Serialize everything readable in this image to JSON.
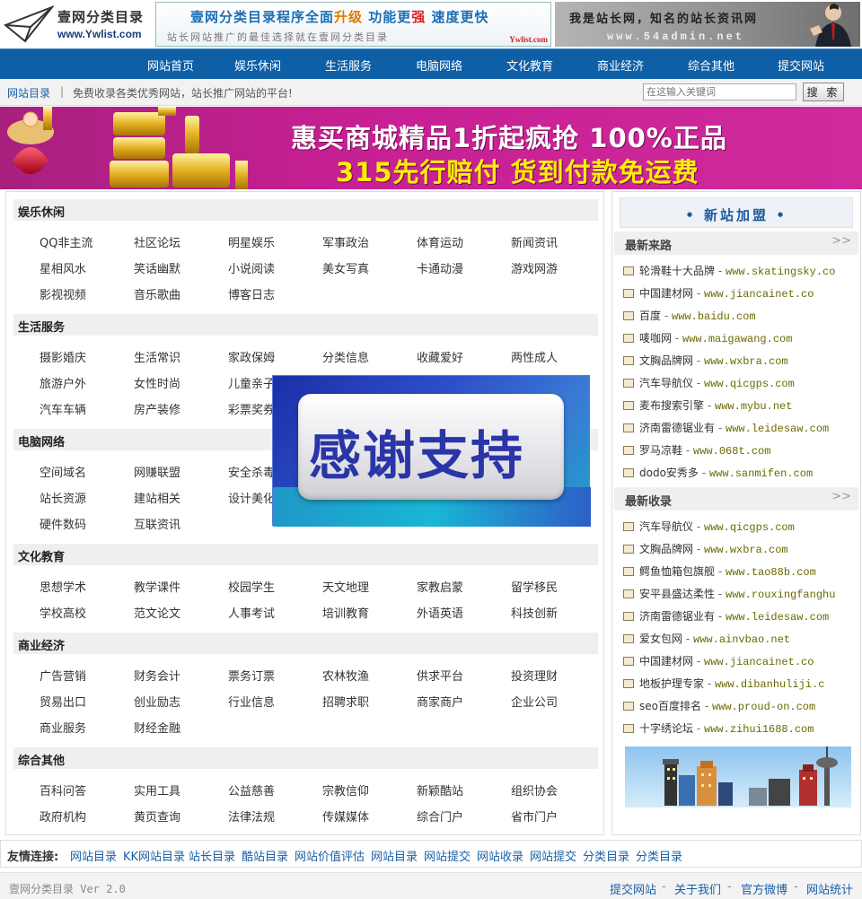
{
  "header": {
    "logo_title": "壹网分类目录",
    "logo_url": "www.Ywlist.com",
    "ad1": {
      "line1_a": "壹网分类目录程序全面",
      "line1_b": "升级",
      "line1_c": " 功能更",
      "line1_d": "强",
      "line1_e": " 速度更快",
      "line2": "站长网站推广的最佳选择就在壹网分类目录",
      "tag": "Ywlist.com"
    },
    "ad2": {
      "line1": "我是站长网，知名的站长资讯网",
      "line2": "www.54admin.net"
    }
  },
  "nav": [
    "网站首页",
    "娱乐休闲",
    "生活服务",
    "电脑网络",
    "文化教育",
    "商业经济",
    "综合其他",
    "提交网站"
  ],
  "subbar": {
    "crumb": "网站目录",
    "separator": "|",
    "desc": "免费收录各类优秀网站，站长推广网站的平台!",
    "search_placeholder": "在这输入关键词",
    "search_button": "搜 索"
  },
  "banner": {
    "line1": "惠买商城精品1折起疯抢 100%正品",
    "line2": "315先行赔付 货到付款免运费"
  },
  "categories": [
    {
      "title": "娱乐休闲",
      "links": [
        "QQ非主流",
        "社区论坛",
        "明星娱乐",
        "军事政治",
        "体育运动",
        "新闻资讯",
        "星相风水",
        "笑话幽默",
        "小说阅读",
        "美女写真",
        "卡通动漫",
        "游戏网游",
        "影视视频",
        "音乐歌曲",
        "博客日志"
      ]
    },
    {
      "title": "生活服务",
      "links": [
        "摄影婚庆",
        "生活常识",
        "家政保姆",
        "分类信息",
        "收藏爱好",
        "两性成人",
        "旅游户外",
        "女性时尚",
        "儿童亲子",
        "",
        "",
        "",
        "汽车车辆",
        "房产装修",
        "彩票奖券"
      ]
    },
    {
      "title": "电脑网络",
      "links": [
        "空间域名",
        "网赚联盟",
        "安全杀毒",
        "",
        "",
        "",
        "站长资源",
        "建站相关",
        "设计美化",
        "",
        "",
        "",
        "硬件数码",
        "互联资讯"
      ]
    },
    {
      "title": "文化教育",
      "links": [
        "思想学术",
        "教学课件",
        "校园学生",
        "天文地理",
        "家教启蒙",
        "留学移民",
        "学校高校",
        "范文论文",
        "人事考试",
        "培训教育",
        "外语英语",
        "科技创新"
      ]
    },
    {
      "title": "商业经济",
      "links": [
        "广告营销",
        "财务会计",
        "票务订票",
        "农林牧渔",
        "供求平台",
        "投资理财",
        "贸易出口",
        "创业励志",
        "行业信息",
        "招聘求职",
        "商家商户",
        "企业公司",
        "商业服务",
        "财经金融"
      ]
    },
    {
      "title": "综合其他",
      "links": [
        "百科问答",
        "实用工具",
        "公益慈善",
        "宗教信仰",
        "新颖酷站",
        "组织协会",
        "政府机构",
        "黄页查询",
        "法律法规",
        "传媒媒体",
        "综合门户",
        "省市门户"
      ]
    }
  ],
  "popup": {
    "text": "感谢支持"
  },
  "sidebar": {
    "join": "• 新站加盟 •",
    "latest_visits": {
      "title": "最新来路",
      "more": ">>",
      "items": [
        {
          "name": "轮滑鞋十大品牌",
          "url": "www.skatingsky.co"
        },
        {
          "name": "中国建材网",
          "url": "www.jiancainet.co"
        },
        {
          "name": "百度",
          "url": "www.baidu.com"
        },
        {
          "name": "唛咖网",
          "url": "www.maigawang.com"
        },
        {
          "name": "文胸品牌网",
          "url": "www.wxbra.com"
        },
        {
          "name": "汽车导航仪",
          "url": "www.qicgps.com"
        },
        {
          "name": "麦布搜索引擎",
          "url": "www.mybu.net"
        },
        {
          "name": "济南雷德锯业有",
          "url": "www.leidesaw.com"
        },
        {
          "name": "罗马凉鞋",
          "url": "www.068t.com"
        },
        {
          "name": "dodo安秀多",
          "url": "www.sanmifen.com"
        }
      ]
    },
    "latest_added": {
      "title": "最新收录",
      "more": ">>",
      "items": [
        {
          "name": "汽车导航仪",
          "url": "www.qicgps.com"
        },
        {
          "name": "文胸品牌网",
          "url": "www.wxbra.com"
        },
        {
          "name": "鳄鱼恤箱包旗舰",
          "url": "www.tao88b.com"
        },
        {
          "name": "安平县盛达柔性",
          "url": "www.rouxingfanghu"
        },
        {
          "name": "济南雷德锯业有",
          "url": "www.leidesaw.com"
        },
        {
          "name": "爱女包网",
          "url": "www.ainvbao.net"
        },
        {
          "name": "中国建材网",
          "url": "www.jiancainet.co"
        },
        {
          "name": "地板护理专家",
          "url": "www.dibanhuliji.c"
        },
        {
          "name": "seo百度排名",
          "url": "www.proud-on.com"
        },
        {
          "name": "十字绣论坛",
          "url": "www.zihui1688.com"
        }
      ]
    }
  },
  "friends": {
    "label": "友情连接:",
    "links": [
      "网站目录",
      "KK网站目录",
      "站长目录",
      "酷站目录",
      "网站价值评估",
      "网站目录",
      "网站提交",
      "网站收录",
      "网站提交",
      "分类目录",
      "分类目录"
    ]
  },
  "footer": {
    "version": "壹网分类目录 Ver 2.0",
    "links": [
      "提交网站",
      "关于我们",
      "官方微博",
      "网站统计"
    ],
    "separator": "-"
  }
}
